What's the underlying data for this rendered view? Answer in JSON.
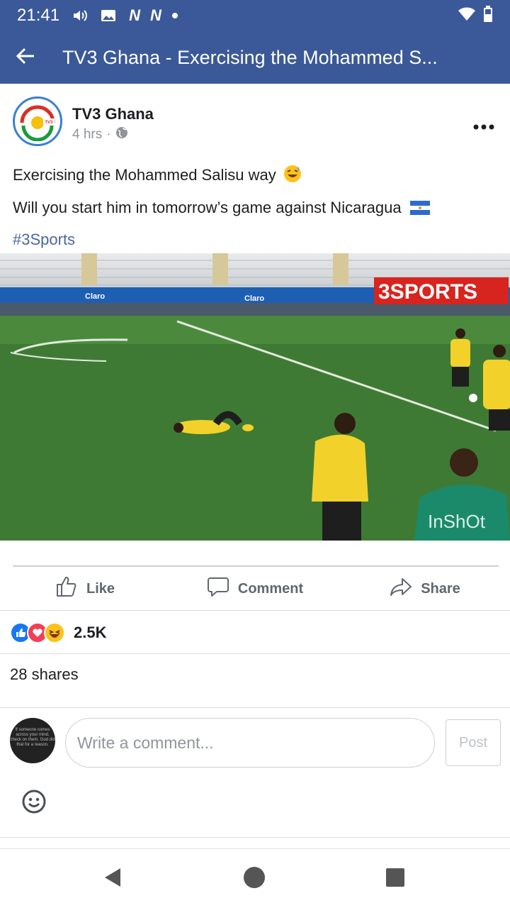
{
  "status_bar": {
    "time": "21:41",
    "network_badges": [
      "N",
      "N"
    ]
  },
  "app_bar": {
    "title": "TV3 Ghana - Exercising the Mohammed S..."
  },
  "post": {
    "author": "TV3 Ghana",
    "time_ago": "4 hrs",
    "separator": "·",
    "line1": "Exercising the Mohammed Salisu way",
    "line2": "Will you start him in tomorrow’s game against Nicaragua",
    "hashtag": "#3Sports",
    "video": {
      "channel_logo_text": "3SPORTS",
      "watermark": "InShOt",
      "ad_board_text": "Claro"
    }
  },
  "actions": {
    "like": "Like",
    "comment": "Comment",
    "share": "Share"
  },
  "reactions": {
    "count": "2.5K"
  },
  "shares_text": "28 shares",
  "comment_box": {
    "placeholder": "Write a comment...",
    "post_button": "Post",
    "avatar_caption": "If someone comes across your mind, check on them. God did that for a reason."
  },
  "colors": {
    "brand": "#3b5998",
    "link": "#4b67a1",
    "pitch": "#3f7a34",
    "jersey": "#f2d22a"
  },
  "icons": {
    "back": "arrow-left-icon",
    "more": "more-horizontal-icon",
    "globe": "globe-icon",
    "like": "thumbs-up-icon",
    "comment": "speech-bubble-icon",
    "share": "share-arrow-icon",
    "emoji": "smiley-icon"
  }
}
